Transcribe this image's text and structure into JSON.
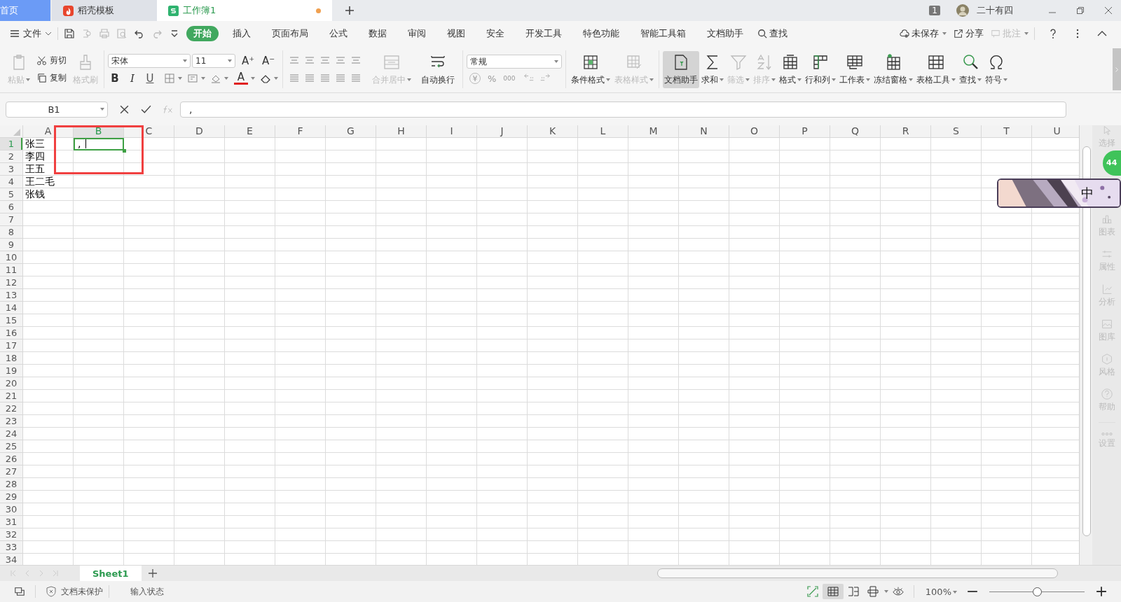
{
  "tabs": [
    {
      "label": "首页",
      "kind": "home",
      "selected": false,
      "modified": false
    },
    {
      "label": "稻壳模板",
      "kind": "docer",
      "selected": false,
      "modified": false
    },
    {
      "label": "工作簿1",
      "kind": "sheet",
      "selected": true,
      "modified": true
    }
  ],
  "account": {
    "window_count": "1",
    "user": "二十有四"
  },
  "menu": {
    "file": "文件",
    "tabs": [
      {
        "label": "开始",
        "selected": true
      },
      {
        "label": "插入",
        "selected": false
      },
      {
        "label": "页面布局",
        "selected": false
      },
      {
        "label": "公式",
        "selected": false
      },
      {
        "label": "数据",
        "selected": false
      },
      {
        "label": "审阅",
        "selected": false
      },
      {
        "label": "视图",
        "selected": false
      },
      {
        "label": "安全",
        "selected": false
      },
      {
        "label": "开发工具",
        "selected": false
      },
      {
        "label": "特色功能",
        "selected": false
      },
      {
        "label": "智能工具箱",
        "selected": false
      },
      {
        "label": "文档助手",
        "selected": false
      }
    ],
    "search": "查找",
    "actions": [
      {
        "label": "未保存",
        "kind": "cloud",
        "disabled": false
      },
      {
        "label": "分享",
        "kind": "share",
        "disabled": false
      },
      {
        "label": "批注",
        "kind": "comment",
        "disabled": true
      }
    ]
  },
  "ribbon": {
    "clipboard": {
      "paste": {
        "label": "粘贴",
        "disabled": true
      },
      "cut": "剪切",
      "copy": "复制",
      "painter": {
        "label": "格式刷",
        "disabled": true
      }
    },
    "font": {
      "name": "宋体",
      "size": "11",
      "grow": "A⁺",
      "shrink": "A⁻",
      "styles": [
        {
          "label": "B",
          "kind": "bold"
        },
        {
          "label": "I",
          "kind": "italic"
        },
        {
          "label": "U",
          "kind": "underline"
        }
      ],
      "color_button": "A"
    },
    "alignment": {
      "merge": {
        "label": "合并居中",
        "disabled": true
      },
      "wrap": {
        "label": "自动换行",
        "disabled": false
      }
    },
    "number": {
      "format": "常规",
      "buttons": [
        {
          "label": "¥",
          "kind": "currency"
        },
        {
          "label": "%",
          "kind": "percent"
        },
        {
          "label": "000",
          "kind": "thousands"
        }
      ]
    },
    "styles": [
      {
        "label": "条件格式",
        "kind": "conditional",
        "disabled": false,
        "pressed": false,
        "dropdown": true
      },
      {
        "label": "表格样式",
        "kind": "style",
        "disabled": true,
        "pressed": false,
        "dropdown": true
      }
    ],
    "tools": [
      {
        "label": "文档助手",
        "kind": "assistant",
        "disabled": false,
        "pressed": true,
        "dropdown": false
      },
      {
        "label": "求和",
        "kind": "sum",
        "disabled": false,
        "pressed": false,
        "dropdown": true
      },
      {
        "label": "筛选",
        "kind": "filter",
        "disabled": true,
        "pressed": false,
        "dropdown": true
      },
      {
        "label": "排序",
        "kind": "sort",
        "disabled": true,
        "pressed": false,
        "dropdown": true
      },
      {
        "label": "格式",
        "kind": "format",
        "disabled": false,
        "pressed": false,
        "dropdown": true
      },
      {
        "label": "行和列",
        "kind": "rowcol",
        "disabled": false,
        "pressed": false,
        "dropdown": true
      },
      {
        "label": "工作表",
        "kind": "worksheet",
        "disabled": false,
        "pressed": false,
        "dropdown": true
      },
      {
        "label": "冻结窗格",
        "kind": "freeze",
        "disabled": false,
        "pressed": false,
        "dropdown": true
      },
      {
        "label": "表格工具",
        "kind": "tabletools",
        "disabled": false,
        "pressed": false,
        "dropdown": true
      },
      {
        "label": "查找",
        "kind": "find",
        "disabled": false,
        "pressed": false,
        "dropdown": true
      },
      {
        "label": "符号",
        "kind": "symbol",
        "disabled": false,
        "pressed": false,
        "dropdown": true
      }
    ]
  },
  "formula_bar": {
    "name_box": "B1",
    "formula": ","
  },
  "sheet": {
    "columns": [
      {
        "label": "A",
        "selected": false
      },
      {
        "label": "B",
        "selected": true
      },
      {
        "label": "C",
        "selected": false
      },
      {
        "label": "D",
        "selected": false
      },
      {
        "label": "E",
        "selected": false
      },
      {
        "label": "F",
        "selected": false
      },
      {
        "label": "G",
        "selected": false
      },
      {
        "label": "H",
        "selected": false
      },
      {
        "label": "I",
        "selected": false
      },
      {
        "label": "J",
        "selected": false
      },
      {
        "label": "K",
        "selected": false
      },
      {
        "label": "L",
        "selected": false
      },
      {
        "label": "M",
        "selected": false
      },
      {
        "label": "N",
        "selected": false
      },
      {
        "label": "O",
        "selected": false
      },
      {
        "label": "P",
        "selected": false
      },
      {
        "label": "Q",
        "selected": false
      },
      {
        "label": "R",
        "selected": false
      },
      {
        "label": "S",
        "selected": false
      },
      {
        "label": "T",
        "selected": false
      },
      {
        "label": "U",
        "selected": false
      }
    ],
    "rows": [
      {
        "label": "1",
        "selected": true,
        "cells": [
          {
            "text": "张三",
            "selected": false
          },
          {
            "text": ",",
            "selected": true
          }
        ]
      },
      {
        "label": "2",
        "selected": false,
        "cells": [
          {
            "text": "李四",
            "selected": false
          }
        ]
      },
      {
        "label": "3",
        "selected": false,
        "cells": [
          {
            "text": "王五",
            "selected": false
          }
        ]
      },
      {
        "label": "4",
        "selected": false,
        "cells": [
          {
            "text": "王二毛",
            "selected": false
          }
        ]
      },
      {
        "label": "5",
        "selected": false,
        "cells": [
          {
            "text": "张钱",
            "selected": false
          }
        ]
      },
      {
        "label": "6",
        "selected": false
      },
      {
        "label": "7",
        "selected": false
      },
      {
        "label": "8",
        "selected": false
      },
      {
        "label": "9",
        "selected": false
      },
      {
        "label": "10",
        "selected": false
      },
      {
        "label": "11",
        "selected": false
      },
      {
        "label": "12",
        "selected": false
      },
      {
        "label": "13",
        "selected": false
      },
      {
        "label": "14",
        "selected": false
      },
      {
        "label": "15",
        "selected": false
      },
      {
        "label": "16",
        "selected": false
      },
      {
        "label": "17",
        "selected": false
      },
      {
        "label": "18",
        "selected": false
      },
      {
        "label": "19",
        "selected": false
      },
      {
        "label": "20",
        "selected": false
      },
      {
        "label": "21",
        "selected": false
      },
      {
        "label": "22",
        "selected": false
      },
      {
        "label": "23",
        "selected": false
      },
      {
        "label": "24",
        "selected": false
      },
      {
        "label": "25",
        "selected": false
      },
      {
        "label": "26",
        "selected": false
      },
      {
        "label": "27",
        "selected": false
      },
      {
        "label": "28",
        "selected": false
      },
      {
        "label": "29",
        "selected": false
      },
      {
        "label": "30",
        "selected": false
      },
      {
        "label": "31",
        "selected": false
      },
      {
        "label": "32",
        "selected": false
      },
      {
        "label": "33",
        "selected": false
      },
      {
        "label": "34",
        "selected": false
      }
    ]
  },
  "side_panel": [
    {
      "label": "选择",
      "kind": "select"
    },
    {
      "label": "图表",
      "kind": "chart"
    },
    {
      "label": "属性",
      "kind": "properties"
    },
    {
      "label": "分析",
      "kind": "analysis"
    },
    {
      "label": "图库",
      "kind": "gallery"
    },
    {
      "label": "风格",
      "kind": "style"
    },
    {
      "label": "帮助",
      "kind": "help"
    },
    {
      "label": "设置",
      "kind": "settings"
    }
  ],
  "ime": {
    "mode": "中",
    "kind": "picture"
  },
  "notification": {
    "count": "44"
  },
  "sheet_tabs": [
    {
      "label": "Sheet1",
      "selected": true
    }
  ],
  "status_bar": {
    "protection": "文档未保护",
    "mode": "输入状态",
    "zoom": "100%",
    "zoom_slider": {
      "level": 0.5
    }
  }
}
